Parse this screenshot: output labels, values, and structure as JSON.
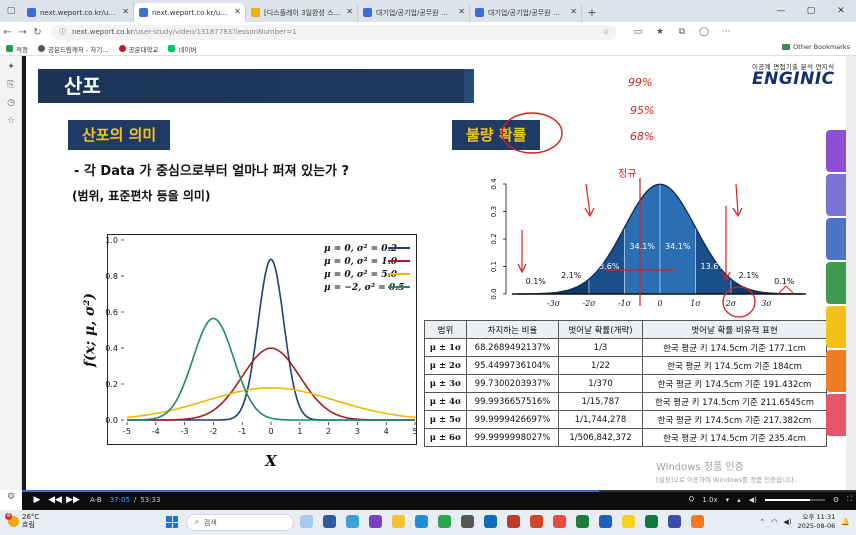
{
  "browser": {
    "tabs": [
      {
        "title": "next.weport.co.kr/user-study",
        "active": false
      },
      {
        "title": "next.weport.co.kr/user-study/v",
        "active": true
      },
      {
        "title": "[디스플레이 3일완성 스터디]",
        "active": false
      },
      {
        "title": "대기업/공기업/공무원 인강, 기",
        "active": false
      },
      {
        "title": "대기업/공기업/공무원 인강, 기",
        "active": false
      }
    ],
    "url_host": "next.weport.co.kr",
    "url_path": "/user-study/video/13187783?lessonNumber=1",
    "bookmarks": [
      "적정",
      "공운드림캐처 - 자기...",
      "공운대학교",
      "네이버"
    ],
    "other_bookmarks": "Other Bookmarks"
  },
  "slide": {
    "title": "산포",
    "brand_sub": "이공계 면접기출 분석 연지식",
    "brand": "ENGINIC",
    "left_heading": "산포의 의미",
    "right_heading": "불량 확률",
    "bullet1": "- 각 Data 가 중심으로부터 얼마나 퍼져 있는가 ?",
    "bullet2": "(범위, 표준편차 등을 의미)",
    "annotations": {
      "a1": "99%",
      "a2": "95%",
      "a3": "68%",
      "a4": "정규"
    }
  },
  "chart_data": [
    {
      "type": "line",
      "title": "",
      "xlabel": "X",
      "ylabel": "f(x; μ, σ²)",
      "xlim": [
        -5,
        5
      ],
      "ylim": [
        0,
        1.0
      ],
      "x_ticks": [
        "-5",
        "-4",
        "-3",
        "-2",
        "-1",
        "0",
        "1",
        "2",
        "3",
        "4",
        "5"
      ],
      "y_ticks": [
        "0.0",
        "0.2",
        "0.4",
        "0.6",
        "0.8",
        "1.0"
      ],
      "legend_position": "top-right",
      "series": [
        {
          "name": "μ = 0,   σ² = 0.2",
          "mu": 0,
          "var": 0.2,
          "color": "#1f3f7a"
        },
        {
          "name": "μ = 0,   σ² = 1.0",
          "mu": 0,
          "var": 1.0,
          "color": "#a31f24"
        },
        {
          "name": "μ = 0,   σ² = 5.0",
          "mu": 0,
          "var": 5.0,
          "color": "#f2b600"
        },
        {
          "name": "μ = −2, σ² = 0.5",
          "mu": -2,
          "var": 0.5,
          "color": "#1a8a6b"
        }
      ]
    },
    {
      "type": "area",
      "title": "",
      "xlim": [
        -4,
        4
      ],
      "ylim": [
        0,
        0.4
      ],
      "x_ticks": [
        "-3σ",
        "-2σ",
        "-1σ",
        "0",
        "1σ",
        "2σ",
        "3σ"
      ],
      "y_ticks": [
        "0.0",
        "0.1",
        "0.2",
        "0.3",
        "0.4"
      ],
      "band_labels": [
        {
          "x": -3.5,
          "label": "0.1%"
        },
        {
          "x": -2.5,
          "label": "2.1%"
        },
        {
          "x": -1.5,
          "label": "13.6%"
        },
        {
          "x": -0.5,
          "label": "34.1%"
        },
        {
          "x": 0.5,
          "label": "34.1%"
        },
        {
          "x": 1.5,
          "label": "13.6%"
        },
        {
          "x": 2.5,
          "label": "2.1%"
        },
        {
          "x": 3.5,
          "label": "0.1%"
        }
      ],
      "colors": {
        "fill": "#1a4f8a",
        "inner": "#2b6fb3",
        "outer": "#0e3a6b"
      }
    }
  ],
  "table": {
    "headers": [
      "범위",
      "차지하는 비율",
      "벗어날 확률(개략)",
      "벗어날 확률 비유적 표현"
    ],
    "rows": [
      [
        "μ ± 1σ",
        "68.2689492137%",
        "1/3",
        "한국 평균 키 174.5cm 기준 177.1cm"
      ],
      [
        "μ ± 2σ",
        "95.4499736104%",
        "1/22",
        "한국 평균 키 174.5cm 기준 184cm"
      ],
      [
        "μ ± 3σ",
        "99.7300203937%",
        "1/370",
        "한국 평균 키 174.5cm 기준 191.432cm"
      ],
      [
        "μ ± 4σ",
        "99.9936657516%",
        "1/15,787",
        "한국 평균 키 174.5cm 기준 211.6545cm"
      ],
      [
        "μ ± 5σ",
        "99.9999426697%",
        "1/1,744,278",
        "한국 평균 키 174.5cm 기준 217.382cm"
      ],
      [
        "μ ± 6σ",
        "99.9999998027%",
        "1/506,842,372",
        "한국 평균 키 174.5cm 기준 235.4cm"
      ]
    ]
  },
  "watermark": {
    "line1": "Windows 정품 인증",
    "line2": "[설정]으로 이동하여 Windows를 정품 인증합니다."
  },
  "player": {
    "ab": "A-B",
    "current": "37:05",
    "sep": "/",
    "total": "53:33",
    "speed": "1.0x",
    "progress": 0.692,
    "volume": 0.75
  },
  "taskbar": {
    "temp": "26°C",
    "weather": "흐림",
    "badge": "4",
    "search_placeholder": "검색",
    "time": "오후 11:31",
    "date": "2025-08-06"
  },
  "colors": {
    "title_bar": "#1e3a61",
    "heading_text": "#f4c318",
    "annotation_red": "#d6201c"
  }
}
